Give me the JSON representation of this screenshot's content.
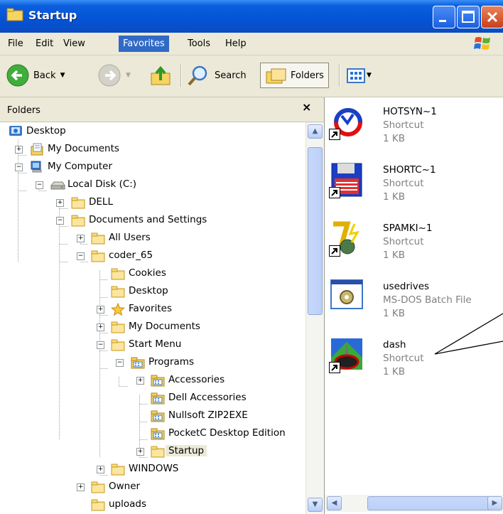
{
  "window": {
    "title": "Startup"
  },
  "menu": [
    "File",
    "Edit",
    "View",
    "Favorites",
    "Tools",
    "Help"
  ],
  "menu_active": "Favorites",
  "toolbar": {
    "back": "Back",
    "search": "Search",
    "folders": "Folders"
  },
  "folders_pane": {
    "title": "Folders",
    "close": "×"
  },
  "tree": [
    {
      "label": "Desktop",
      "icon": "desktop-icon"
    },
    {
      "label": "My Documents",
      "icon": "my-documents-icon",
      "expander": "+"
    },
    {
      "label": "My Computer",
      "icon": "my-computer-icon",
      "expander": "−"
    },
    {
      "label": "Local Disk (C:)",
      "icon": "drive-icon",
      "expander": "−"
    },
    {
      "label": "DELL",
      "icon": "folder-icon",
      "expander": "+"
    },
    {
      "label": "Documents and Settings",
      "icon": "folder-icon",
      "expander": "−"
    },
    {
      "label": "All Users",
      "icon": "folder-icon",
      "expander": "+"
    },
    {
      "label": "coder_65",
      "icon": "folder-icon",
      "expander": "−"
    },
    {
      "label": "Cookies",
      "icon": "folder-icon"
    },
    {
      "label": "Desktop",
      "icon": "folder-icon"
    },
    {
      "label": "Favorites",
      "icon": "favorites-star-icon",
      "expander": "+"
    },
    {
      "label": "My Documents",
      "icon": "folder-icon",
      "expander": "+"
    },
    {
      "label": "Start Menu",
      "icon": "folder-icon",
      "expander": "−"
    },
    {
      "label": "Programs",
      "icon": "program-group-icon",
      "expander": "−"
    },
    {
      "label": "Accessories",
      "icon": "program-group-icon",
      "expander": "+"
    },
    {
      "label": "Dell Accessories",
      "icon": "program-group-icon"
    },
    {
      "label": "Nullsoft ZIP2EXE",
      "icon": "program-group-icon"
    },
    {
      "label": "PocketC Desktop Edition",
      "icon": "program-group-icon"
    },
    {
      "label": "Startup",
      "icon": "folder-icon",
      "expander": "+",
      "selected": true
    },
    {
      "label": "WINDOWS",
      "icon": "folder-icon",
      "expander": "+"
    },
    {
      "label": "Owner",
      "icon": "folder-icon",
      "expander": "+"
    },
    {
      "label": "uploads",
      "icon": "folder-icon"
    }
  ],
  "files": [
    {
      "name": "HOTSYN~1",
      "type": "Shortcut",
      "size": "1 KB",
      "icon": "hotsync-icon"
    },
    {
      "name": "SHORTC~1",
      "type": "Shortcut",
      "size": "1 KB",
      "icon": "floppy-icon"
    },
    {
      "name": "SPAMKI~1",
      "type": "Shortcut",
      "size": "1 KB",
      "icon": "spamkiller-icon"
    },
    {
      "name": "usedrives",
      "type": "MS-DOS Batch File",
      "size": "1 KB",
      "icon": "batch-file-icon"
    },
    {
      "name": "dash",
      "type": "Shortcut",
      "size": "1 KB",
      "icon": "race-car-icon"
    }
  ],
  "scrollbar_arrows": {
    "up": "▲",
    "down": "▼",
    "left": "◀",
    "right": "▶"
  }
}
